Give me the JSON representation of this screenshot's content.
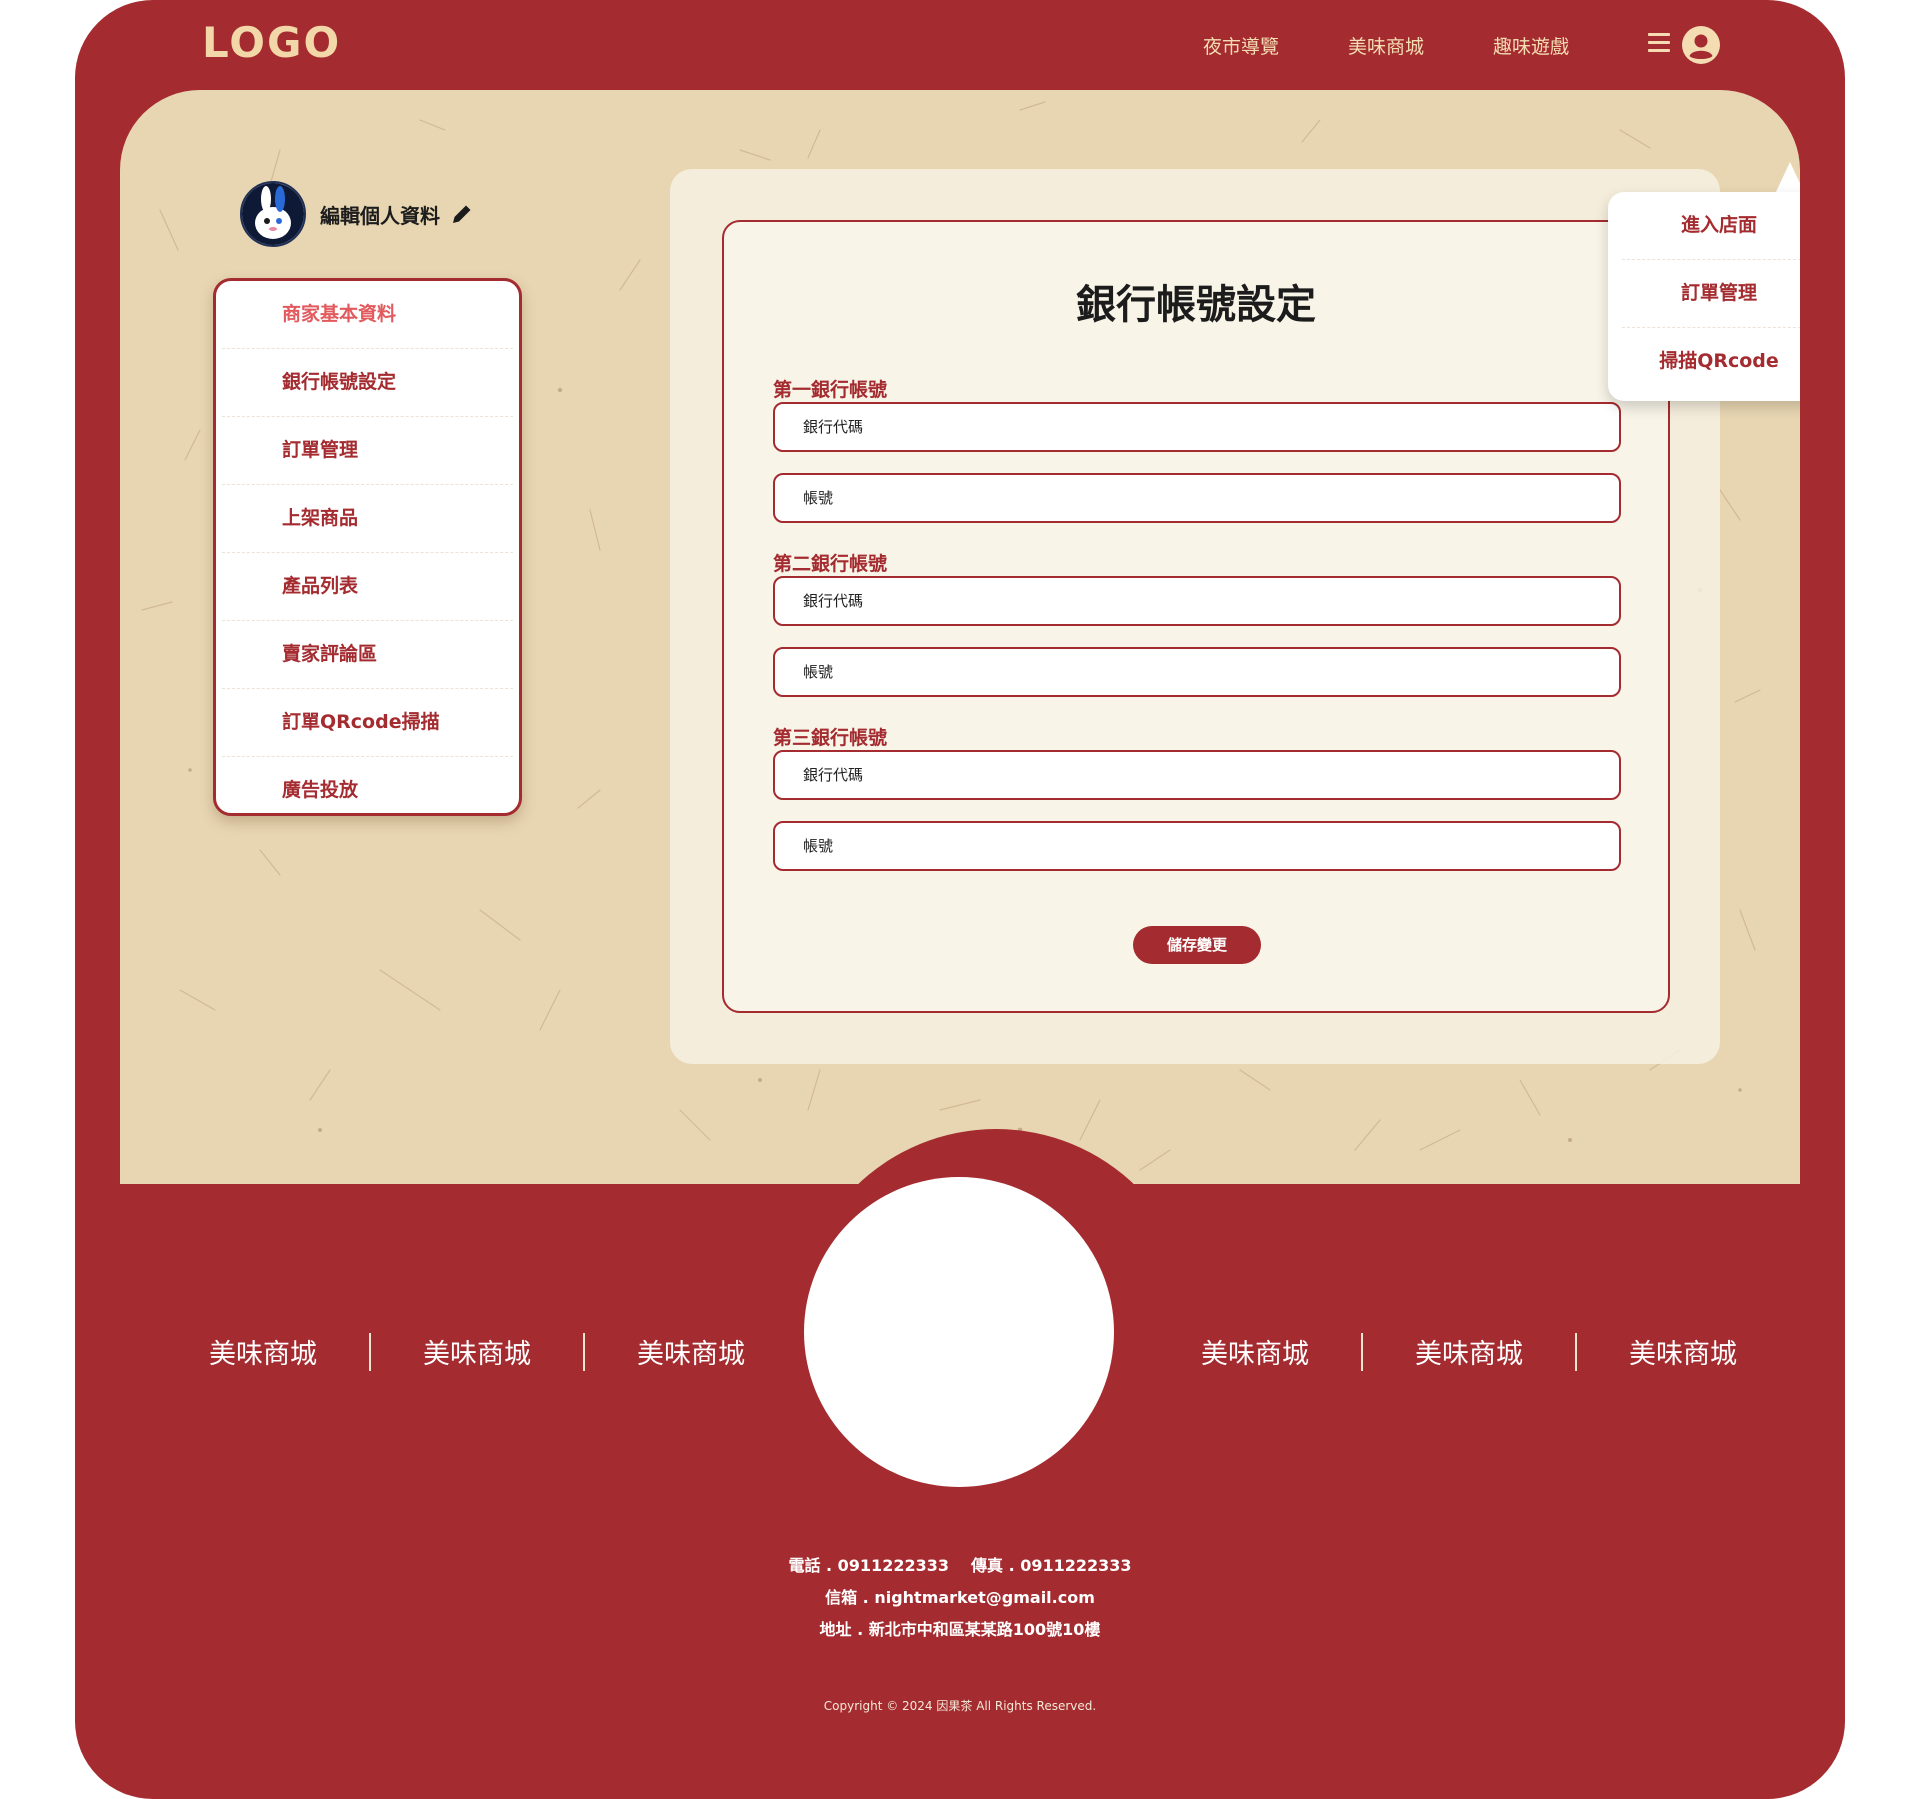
{
  "header": {
    "logo": "LOGO",
    "nav": [
      "夜市導覽",
      "美味商城",
      "趣味遊戲"
    ]
  },
  "dropdown": {
    "items": [
      "進入店面",
      "訂單管理",
      "掃描QRcode"
    ]
  },
  "profile": {
    "edit_label": "編輯個人資料"
  },
  "sidebar": {
    "items": [
      {
        "label": "商家基本資料",
        "active": true
      },
      {
        "label": "銀行帳號設定"
      },
      {
        "label": "訂單管理"
      },
      {
        "label": "上架商品"
      },
      {
        "label": "產品列表"
      },
      {
        "label": "賣家評論區"
      },
      {
        "label": "訂單QRcode掃描"
      },
      {
        "label": "廣告投放"
      }
    ]
  },
  "form": {
    "title": "銀行帳號設定",
    "groups": [
      {
        "label": "第一銀行帳號",
        "bank_code": "銀行代碼",
        "account": "帳號"
      },
      {
        "label": "第二銀行帳號",
        "bank_code": "銀行代碼",
        "account": "帳號"
      },
      {
        "label": "第三銀行帳號",
        "bank_code": "銀行代碼",
        "account": "帳號"
      }
    ],
    "save_label": "儲存變更"
  },
  "footer": {
    "links_left": [
      "美味商城",
      "美味商城",
      "美味商城"
    ],
    "links_right": [
      "美味商城",
      "美味商城",
      "美味商城"
    ],
    "phone": "電話 . 0911222333",
    "fax": "傳真 . 0911222333",
    "email": "信箱 . nightmarket@gmail.com",
    "address": "地址 . 新北市中和區某某路100號10樓",
    "copyright": "Copyright © 2024 因果茶 All Rights Reserved."
  },
  "colors": {
    "brand_red": "#a42b2f",
    "paper": "#e8d6b2",
    "logo_cream": "#f2d7a9",
    "active_pink": "#e25a5e"
  },
  "icons": [
    "menu-icon",
    "user-avatar-icon",
    "pencil-icon",
    "profile-rabbit-avatar"
  ]
}
